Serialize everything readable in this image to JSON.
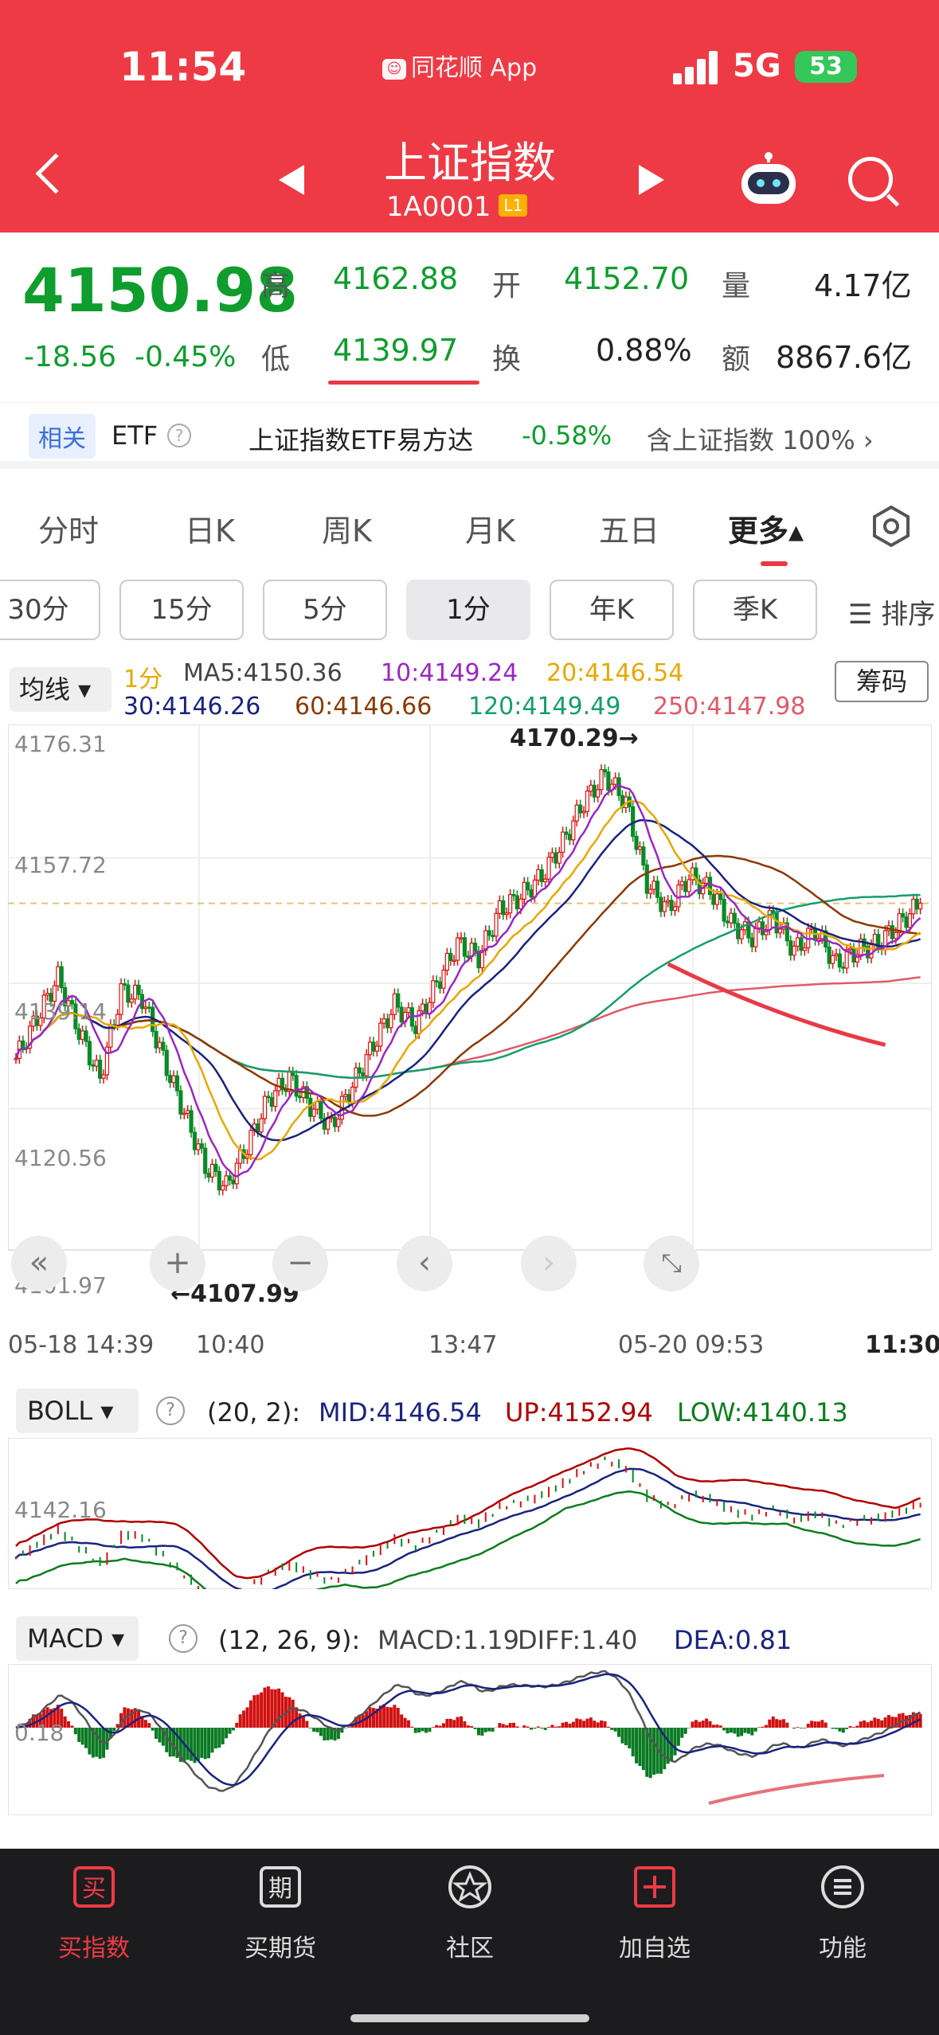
{
  "status": {
    "time": "11:54",
    "app": "同花顺 App",
    "network": "5G",
    "battery": "53"
  },
  "header": {
    "title": "上证指数",
    "code": "1A0001",
    "level": "L1"
  },
  "quote": {
    "price": "4150.98",
    "change": "-18.56",
    "change_pct": "-0.45%",
    "high_label": "高",
    "high": "4162.88",
    "low_label": "低",
    "low": "4139.97",
    "open_label": "开",
    "open": "4152.70",
    "turnover_label": "换",
    "turnover": "0.88%",
    "volume_label": "量",
    "volume": "4.17亿",
    "amount_label": "额",
    "amount": "8867.6亿"
  },
  "etf": {
    "tag": "相关",
    "label": "ETF",
    "name": "上证指数ETF易方达",
    "pct": "-0.58%",
    "contains": "含上证指数 100%"
  },
  "tabs": [
    "分时",
    "日K",
    "周K",
    "月K",
    "五日",
    "更多▴"
  ],
  "periods": [
    "30分",
    "15分",
    "5分",
    "1分",
    "年K",
    "季K"
  ],
  "sort_label": "☰ 排序",
  "ma": {
    "button": "均线 ▾",
    "period": "1分",
    "ma5": "MA5:4150.36",
    "ma10": "10:4149.24",
    "ma20": "20:4146.54",
    "ma30": "30:4146.26",
    "ma60": "60:4146.66",
    "ma120": "120:4149.49",
    "ma250": "250:4147.98",
    "chips": "筹码",
    "colors": {
      "ma5": "#e7a800",
      "ma10": "#9b27c4",
      "ma20": "#e7a800",
      "ma30": "#1a237e",
      "ma60": "#8b3a00",
      "ma120": "#159e6b",
      "ma250": "#e05a68"
    }
  },
  "chart_data": [
    {
      "type": "candlestick",
      "title": "上证指数 1分",
      "y_ticks": [
        "4176.31",
        "4157.72",
        "4139.14",
        "4120.56",
        "4101.97"
      ],
      "x_ticks": [
        "05-18 14:39",
        "10:40",
        "13:47",
        "05-20 09:53",
        "11:30"
      ],
      "ylim": [
        4101.97,
        4176.31
      ],
      "annotations": {
        "high": "4170.29→",
        "low": "←4107.99"
      },
      "close_series": [
        4128,
        4134,
        4140,
        4132,
        4125,
        4138,
        4137,
        4128,
        4120,
        4112,
        4109,
        4115,
        4122,
        4125,
        4121,
        4118,
        4124,
        4130,
        4136,
        4133,
        4139,
        4145,
        4143,
        4150,
        4152,
        4155,
        4160,
        4166,
        4170,
        4166,
        4154,
        4150,
        4155,
        4153,
        4148,
        4146,
        4149,
        4144,
        4147,
        4142,
        4144,
        4145,
        4148,
        4151
      ],
      "grid": true
    },
    {
      "type": "line",
      "title": "BOLL",
      "params": "(20, 2):",
      "mid": "MID:4146.54",
      "up": "UP:4152.94",
      "low": "LOW:4140.13",
      "y_tick": "4142.16"
    },
    {
      "type": "bar",
      "title": "MACD",
      "params": "(12, 26, 9):",
      "macd": "MACD:1.19",
      "diff": "DIFF:1.40",
      "dea": "DEA:0.81",
      "y_tick": "0.18"
    }
  ],
  "bottom_nav": [
    {
      "label": "买指数",
      "icon": "buy-icon"
    },
    {
      "label": "买期货",
      "icon": "futures-icon"
    },
    {
      "label": "社区",
      "icon": "community-icon"
    },
    {
      "label": "加自选",
      "icon": "add-watchlist-icon"
    },
    {
      "label": "功能",
      "icon": "menu-icon"
    }
  ]
}
